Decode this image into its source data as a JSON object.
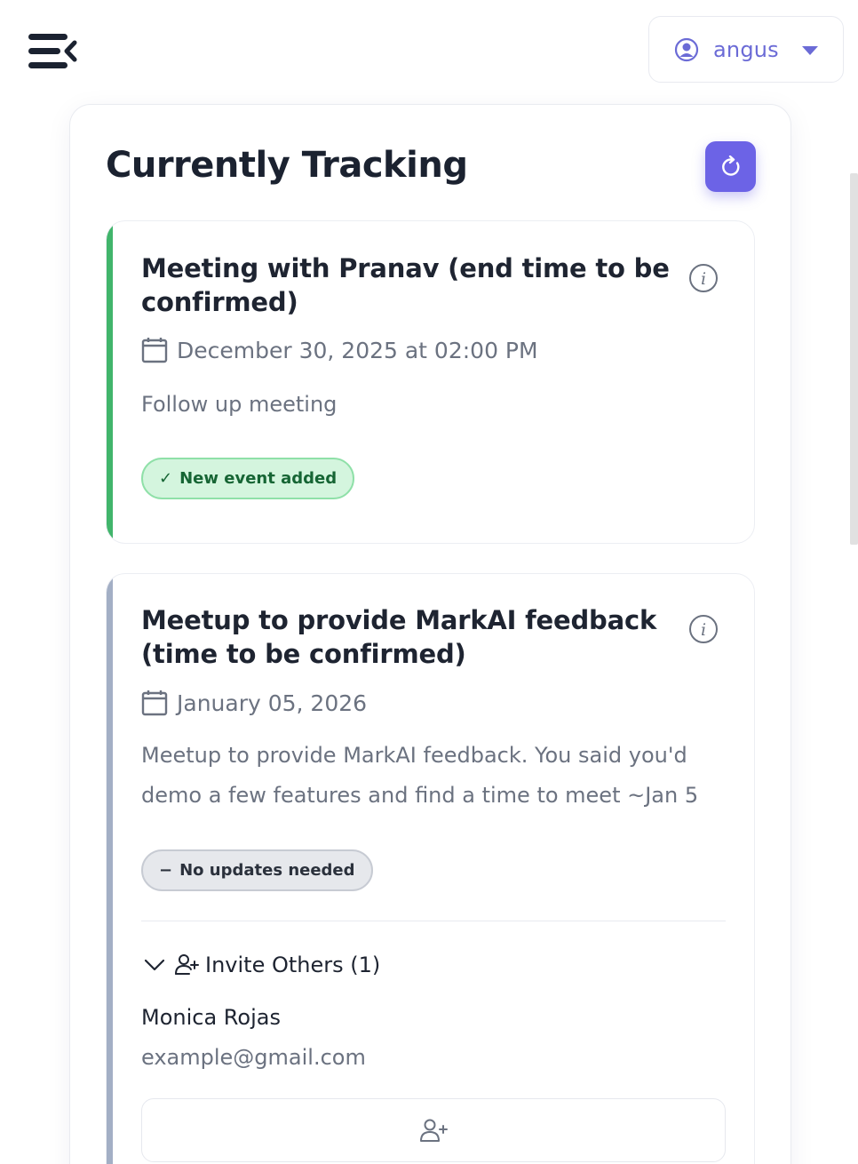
{
  "header": {
    "menu_icon": "menu-collapse-icon",
    "user": {
      "name": "angus",
      "icon": "user-circle-icon",
      "caret": "caret-down-icon"
    }
  },
  "colors": {
    "accent": "#6c63e6",
    "success": "#41b56b",
    "muted_bar": "#a3afc5",
    "user_text": "#6b6bd6"
  },
  "panel": {
    "title": "Currently Tracking",
    "refresh_icon": "refresh-icon"
  },
  "events": [
    {
      "title": "Meeting with Pranav (end time to be confirmed)",
      "date": "December 30, 2025 at 02:00 PM",
      "description": "Follow up meeting",
      "status": {
        "icon": "✓",
        "label": "New event added"
      }
    },
    {
      "title": "Meetup to provide MarkAI feedback (time to be confirmed)",
      "date": "January 05, 2026",
      "description": "Meetup to provide MarkAI feedback. You said you'd demo a few features and find a time to meet ~Jan 5",
      "status": {
        "icon": "−",
        "label": "No updates needed"
      },
      "invite": {
        "label": "Invite Others (1)",
        "people": [
          {
            "name": "Monica Rojas",
            "email": "example@gmail.com"
          }
        ]
      }
    }
  ]
}
